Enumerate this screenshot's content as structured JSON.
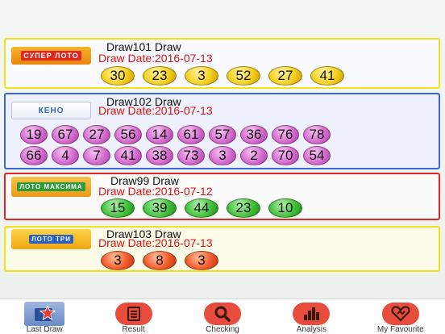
{
  "colors": {
    "card_border_yellow": "#f2e21c",
    "card_border_blue": "#3a66d8",
    "card_border_red": "#e32525",
    "tab_icon_bg": "#e74c3c"
  },
  "draws": [
    {
      "logo": "СУПЕР ЛОТО",
      "title": "Draw101 Draw",
      "date": "Draw Date:2016-07-13",
      "balls": [
        "30",
        "23",
        "3",
        "52",
        "27",
        "41"
      ]
    },
    {
      "logo": "КЕНО",
      "title": "Draw102 Draw",
      "date": "Draw Date:2016-07-13",
      "balls_row1": [
        "19",
        "67",
        "27",
        "56",
        "14",
        "61",
        "57",
        "36",
        "76",
        "78"
      ],
      "balls_row2": [
        "66",
        "4",
        "7",
        "41",
        "38",
        "73",
        "3",
        "2",
        "70",
        "54"
      ]
    },
    {
      "logo": "ЛОТО МАКСИМА",
      "title": "Draw99 Draw",
      "date": "Draw Date:2016-07-12",
      "balls": [
        "15",
        "39",
        "44",
        "23",
        "10"
      ]
    },
    {
      "logo": "ЛОТО ТРИ",
      "title": "Draw103 Draw",
      "date": "Draw Date:2016-07-13",
      "balls": [
        "3",
        "8",
        "3"
      ]
    }
  ],
  "tabs": [
    {
      "label": "Last Draw",
      "icon": "star-icon",
      "selected": true
    },
    {
      "label": "Result",
      "icon": "list-icon"
    },
    {
      "label": "Checking",
      "icon": "search-icon"
    },
    {
      "label": "Analysis",
      "icon": "bar-chart-icon"
    },
    {
      "label": "My Favourite",
      "icon": "heart-icon"
    }
  ]
}
